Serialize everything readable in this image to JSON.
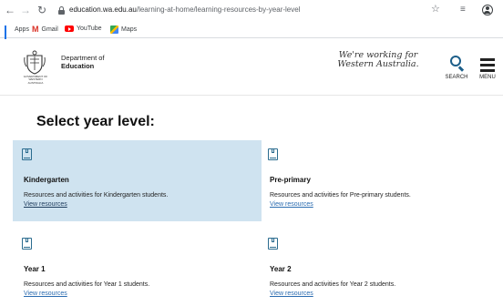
{
  "browser": {
    "url_host": "education.wa.edu.au",
    "url_path": "/learning-at-home/learning-resources-by-year-level",
    "bookmarks": [
      {
        "label": "Apps",
        "icon": "apps-grid-icon"
      },
      {
        "label": "Gmail",
        "icon": "gmail-icon"
      },
      {
        "label": "YouTube",
        "icon": "youtube-icon"
      },
      {
        "label": "Maps",
        "icon": "maps-icon"
      }
    ]
  },
  "header": {
    "dept_line1": "Department of",
    "dept_line2": "Education",
    "crest_caption": "GOVERNMENT OF\nWESTERN AUSTRALIA",
    "slogan": "We're working for\nWestern Australia.",
    "search_label": "SEARCH",
    "menu_label": "MENU"
  },
  "main": {
    "title": "Select year level:",
    "link_label": "View resources",
    "cards": [
      {
        "title": "Kindergarten",
        "desc": "Resources and activities for Kindergarten students."
      },
      {
        "title": "Pre-primary",
        "desc": "Resources and activities for Pre-primary students."
      },
      {
        "title": "Year 1",
        "desc": "Resources and activities for Year 1 students."
      },
      {
        "title": "Year 2",
        "desc": "Resources and activities for Year 2 students."
      }
    ]
  },
  "colors": {
    "highlight": "#cfe3f0",
    "accent": "#1d5f8a",
    "link": "#2b6cb0"
  }
}
